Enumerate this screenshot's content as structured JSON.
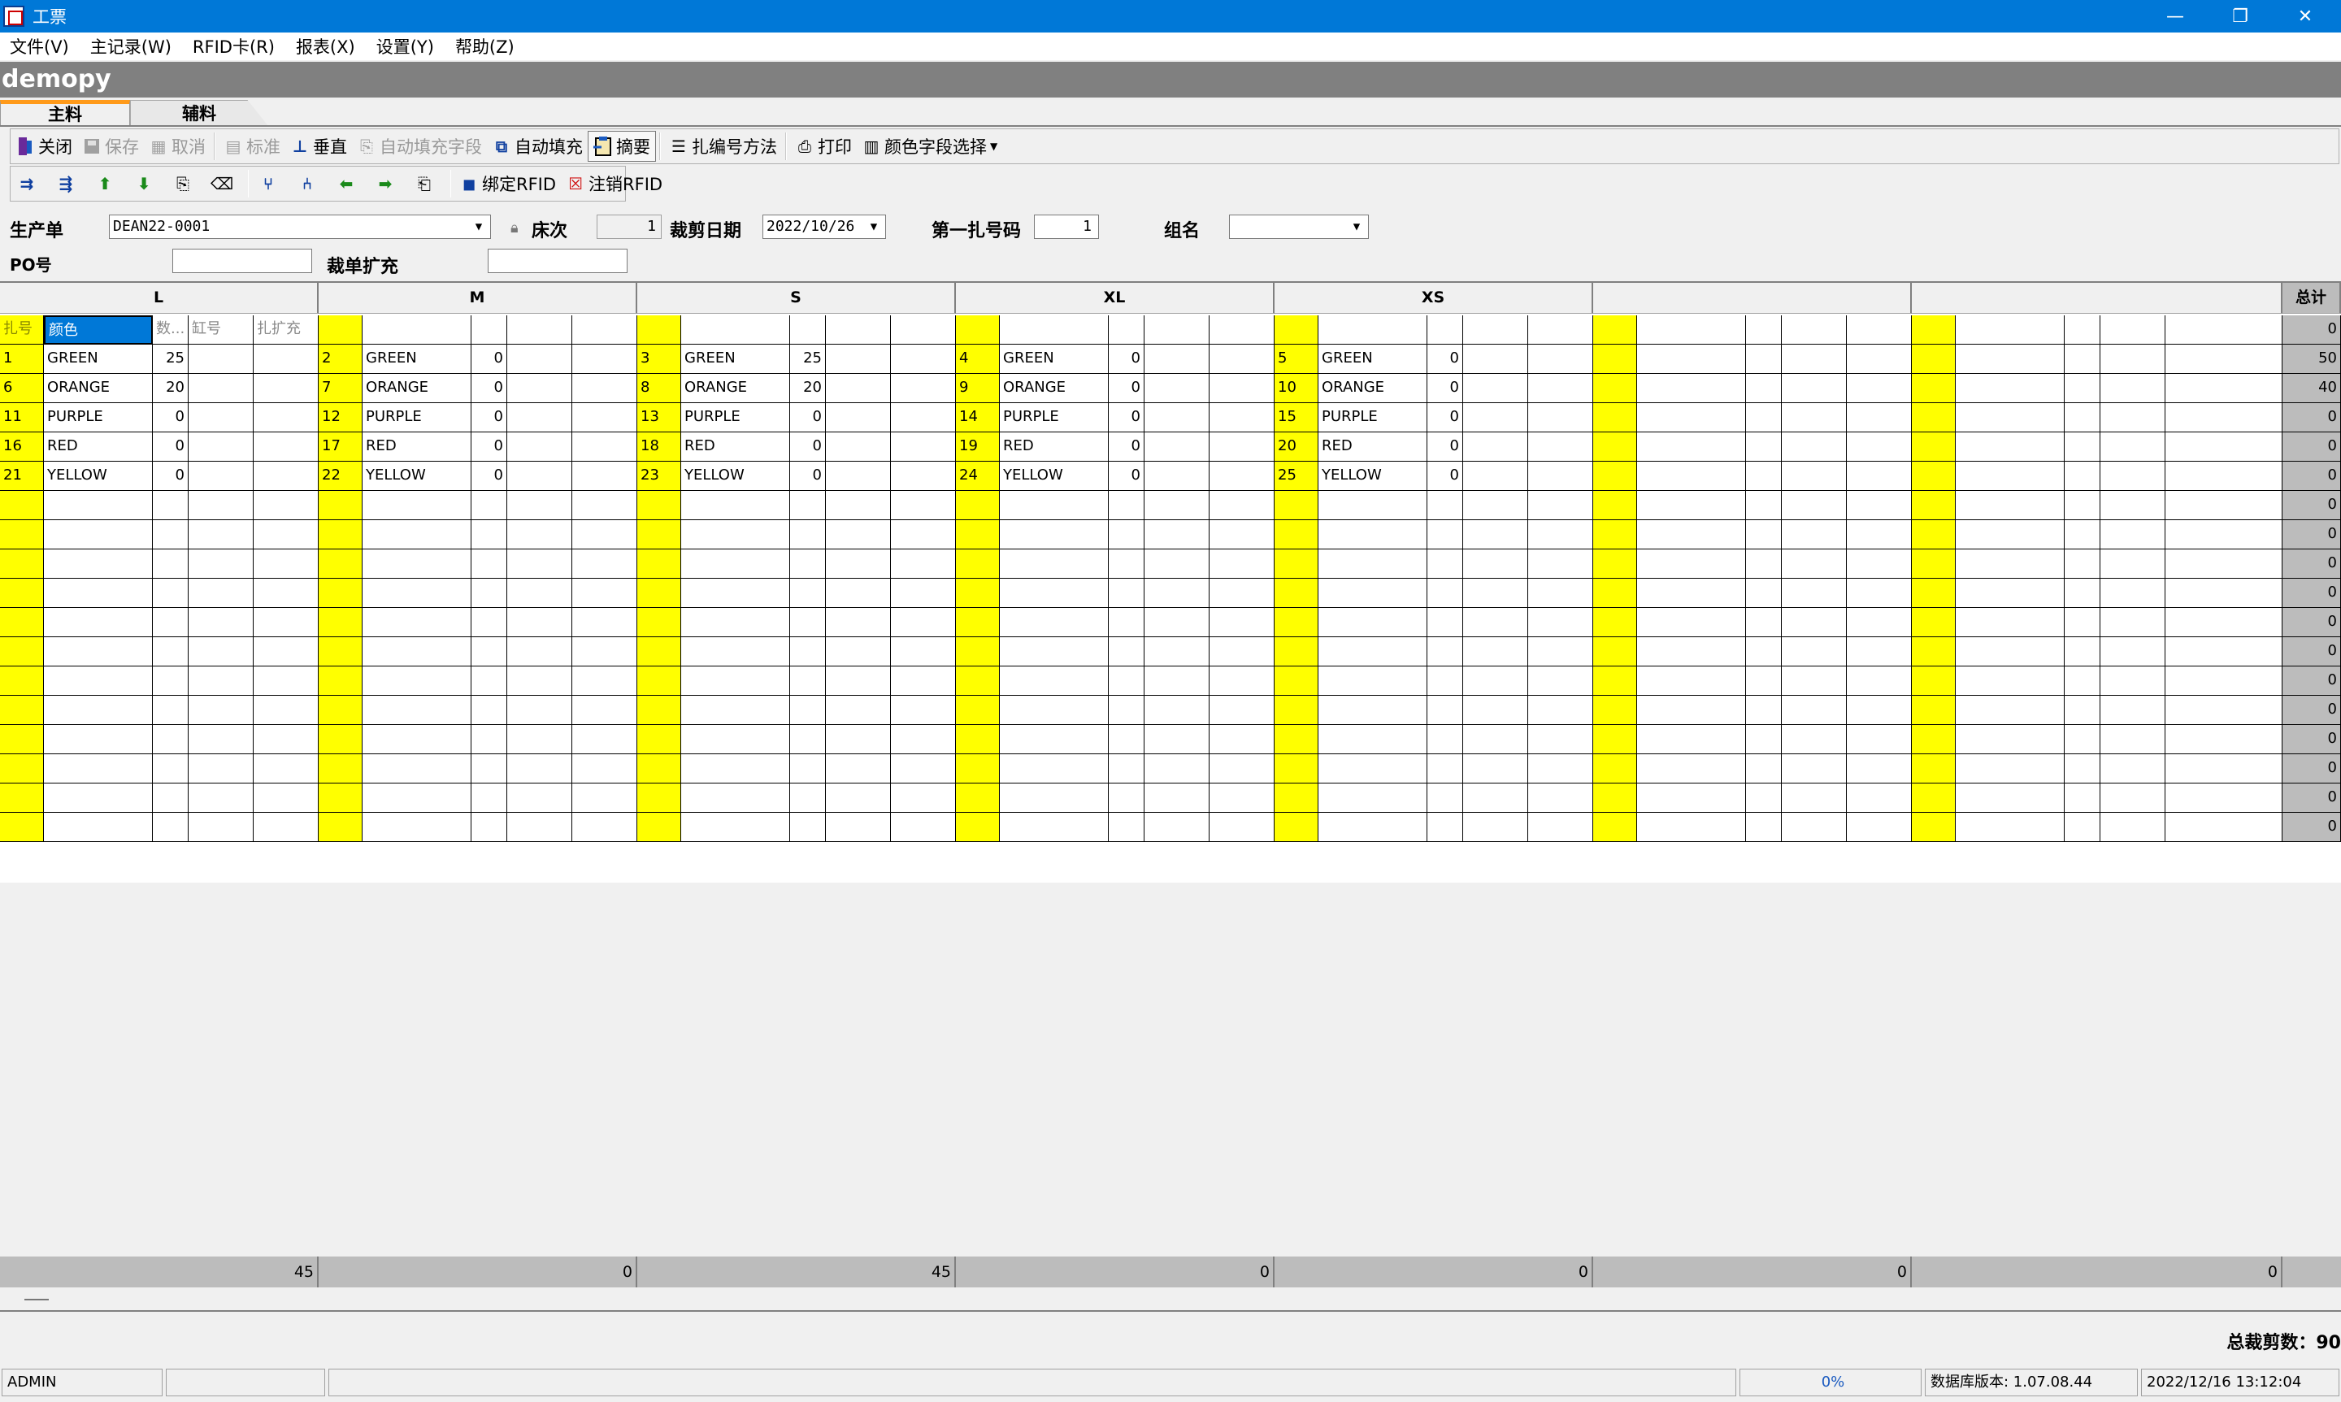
{
  "window": {
    "title": "工票",
    "minimize": "—",
    "restore": "❐",
    "close": "✕"
  },
  "menu": [
    "文件(V)",
    "主记录(W)",
    "RFID卡(R)",
    "报表(X)",
    "设置(Y)",
    "帮助(Z)"
  ],
  "app_header": "demopy",
  "tabs": {
    "main": "主料",
    "aux": "辅料"
  },
  "toolbar1": {
    "close": "关闭",
    "save": "保存",
    "cancel": "取消",
    "standard": "标准",
    "vertical": "垂直",
    "auto_fill_field": "自动填充字段",
    "auto_fill": "自动填充",
    "summary": "摘要",
    "numbering_method": "扎编号方法",
    "print": "打印",
    "color_field_select": "颜色字段选择"
  },
  "toolbar2": {
    "bind_rfid": "绑定RFID",
    "cancel_rfid": "注销RFID"
  },
  "form": {
    "production_order_label": "生产单",
    "production_order_value": "DEAN22-0001",
    "bed_label": "床次",
    "bed_value": "1",
    "cut_date_label": "裁剪日期",
    "cut_date_value": "2022/10/26",
    "first_bundle_label": "第一扎号码",
    "first_bundle_value": "1",
    "group_label": "组名",
    "group_value": "",
    "po_label": "PO号",
    "po_value": "",
    "cut_ext_label": "裁单扩充",
    "cut_ext_value": ""
  },
  "grid": {
    "sizes": [
      "L",
      "M",
      "S",
      "XL",
      "XS",
      "",
      ""
    ],
    "total_header": "总计",
    "sub_headers": [
      "扎号",
      "颜色",
      "数...",
      "缸号",
      "扎扩充"
    ],
    "rows": [
      {
        "total": "0",
        "cells": []
      },
      {
        "total": "50",
        "cells": [
          [
            "1",
            "GREEN",
            "25"
          ],
          [
            "2",
            "GREEN",
            "0"
          ],
          [
            "3",
            "GREEN",
            "25"
          ],
          [
            "4",
            "GREEN",
            "0"
          ],
          [
            "5",
            "GREEN",
            "0"
          ]
        ]
      },
      {
        "total": "40",
        "cells": [
          [
            "6",
            "ORANGE",
            "20"
          ],
          [
            "7",
            "ORANGE",
            "0"
          ],
          [
            "8",
            "ORANGE",
            "20"
          ],
          [
            "9",
            "ORANGE",
            "0"
          ],
          [
            "10",
            "ORANGE",
            "0"
          ]
        ]
      },
      {
        "total": "0",
        "cells": [
          [
            "11",
            "PURPLE",
            "0"
          ],
          [
            "12",
            "PURPLE",
            "0"
          ],
          [
            "13",
            "PURPLE",
            "0"
          ],
          [
            "14",
            "PURPLE",
            "0"
          ],
          [
            "15",
            "PURPLE",
            "0"
          ]
        ]
      },
      {
        "total": "0",
        "cells": [
          [
            "16",
            "RED",
            "0"
          ],
          [
            "17",
            "RED",
            "0"
          ],
          [
            "18",
            "RED",
            "0"
          ],
          [
            "19",
            "RED",
            "0"
          ],
          [
            "20",
            "RED",
            "0"
          ]
        ]
      },
      {
        "total": "0",
        "cells": [
          [
            "21",
            "YELLOW",
            "0"
          ],
          [
            "22",
            "YELLOW",
            "0"
          ],
          [
            "23",
            "YELLOW",
            "0"
          ],
          [
            "24",
            "YELLOW",
            "0"
          ],
          [
            "25",
            "YELLOW",
            "0"
          ]
        ]
      },
      {
        "total": "0",
        "cells": []
      },
      {
        "total": "0",
        "cells": []
      },
      {
        "total": "0",
        "cells": []
      },
      {
        "total": "0",
        "cells": []
      },
      {
        "total": "0",
        "cells": []
      },
      {
        "total": "0",
        "cells": []
      },
      {
        "total": "0",
        "cells": []
      },
      {
        "total": "0",
        "cells": []
      },
      {
        "total": "0",
        "cells": []
      },
      {
        "total": "0",
        "cells": []
      },
      {
        "total": "0",
        "cells": []
      },
      {
        "total": "0",
        "cells": []
      }
    ],
    "column_totals": [
      "45",
      "0",
      "45",
      "0",
      "0",
      "0",
      "0"
    ]
  },
  "total_cut_label": "总裁剪数：90",
  "status": {
    "user": "ADMIN",
    "progress": "0%",
    "db_version": "数据库版本: 1.07.08.44",
    "datetime": "2022/12/16 13:12:04"
  }
}
